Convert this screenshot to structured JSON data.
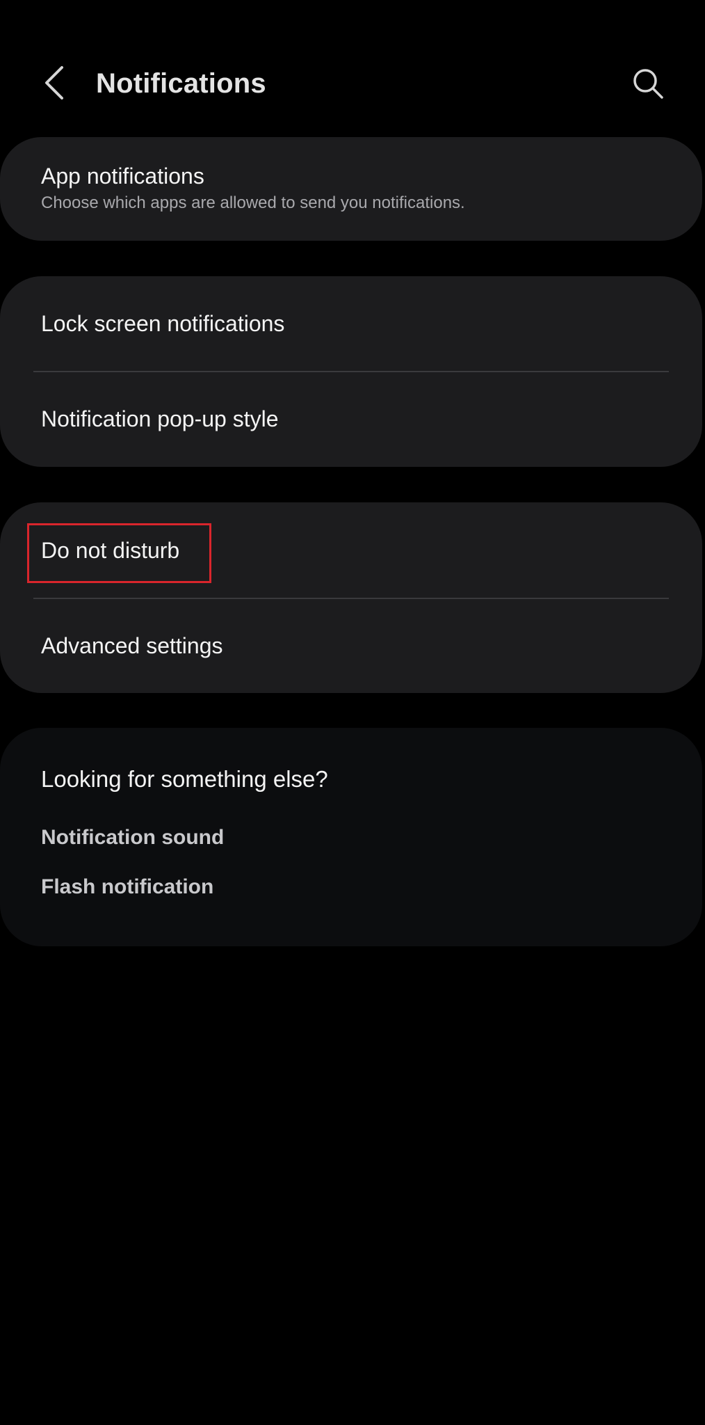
{
  "header": {
    "title": "Notifications",
    "back_icon": "chevron-left-icon",
    "search_icon": "search-icon"
  },
  "cards": {
    "app_notifications": {
      "title": "App notifications",
      "subtitle": "Choose which apps are allowed to send you notifications."
    },
    "lock_screen": {
      "title": "Lock screen notifications"
    },
    "popup_style": {
      "title": "Notification pop-up style"
    },
    "do_not_disturb": {
      "title": "Do not disturb"
    },
    "advanced": {
      "title": "Advanced settings"
    }
  },
  "suggestions": {
    "heading": "Looking for something else?",
    "links": [
      "Notification sound",
      "Flash notification"
    ]
  },
  "colors": {
    "background": "#000000",
    "card": "#1c1c1e",
    "suggestion_card": "#0c0d0f",
    "highlight": "#d9252c"
  }
}
